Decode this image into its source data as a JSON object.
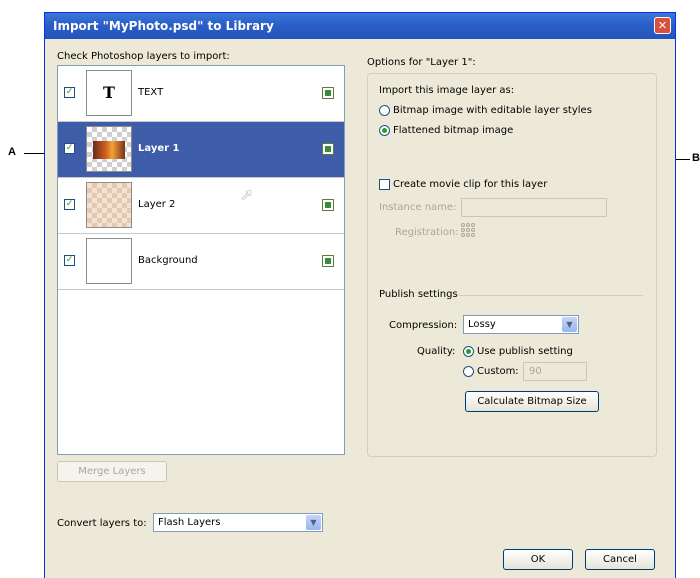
{
  "callouts": {
    "left": "A",
    "right": "B"
  },
  "dialog": {
    "title": "Import \"MyPhoto.psd\" to Library",
    "close_icon": "close-icon"
  },
  "layers_label": "Check Photoshop layers to import:",
  "layers": [
    {
      "name": "TEXT",
      "checked": true,
      "selected": false,
      "thumb": "text"
    },
    {
      "name": "Layer 1",
      "checked": true,
      "selected": true,
      "thumb": "photo"
    },
    {
      "name": "Layer 2",
      "checked": true,
      "selected": false,
      "thumb": "tan"
    },
    {
      "name": "Background",
      "checked": true,
      "selected": false,
      "thumb": "blank"
    }
  ],
  "merge_button": "Merge Layers",
  "convert": {
    "label": "Convert layers to:",
    "value": "Flash Layers"
  },
  "options": {
    "title": "Options for \"Layer 1\":",
    "import_as_label": "Import this image layer as:",
    "radio_bitmap": "Bitmap image with editable layer styles",
    "radio_flattened": "Flattened bitmap image",
    "movie_clip_label": "Create movie clip for this layer",
    "instance_label": "Instance name:",
    "instance_value": "",
    "registration_label": "Registration:",
    "publish_title": "Publish settings",
    "compression_label": "Compression:",
    "compression_value": "Lossy",
    "quality_label": "Quality:",
    "use_publish": "Use publish setting",
    "custom_label": "Custom:",
    "custom_value": "90",
    "calc_button": "Calculate Bitmap Size"
  },
  "ok_button": "OK",
  "cancel_button": "Cancel"
}
